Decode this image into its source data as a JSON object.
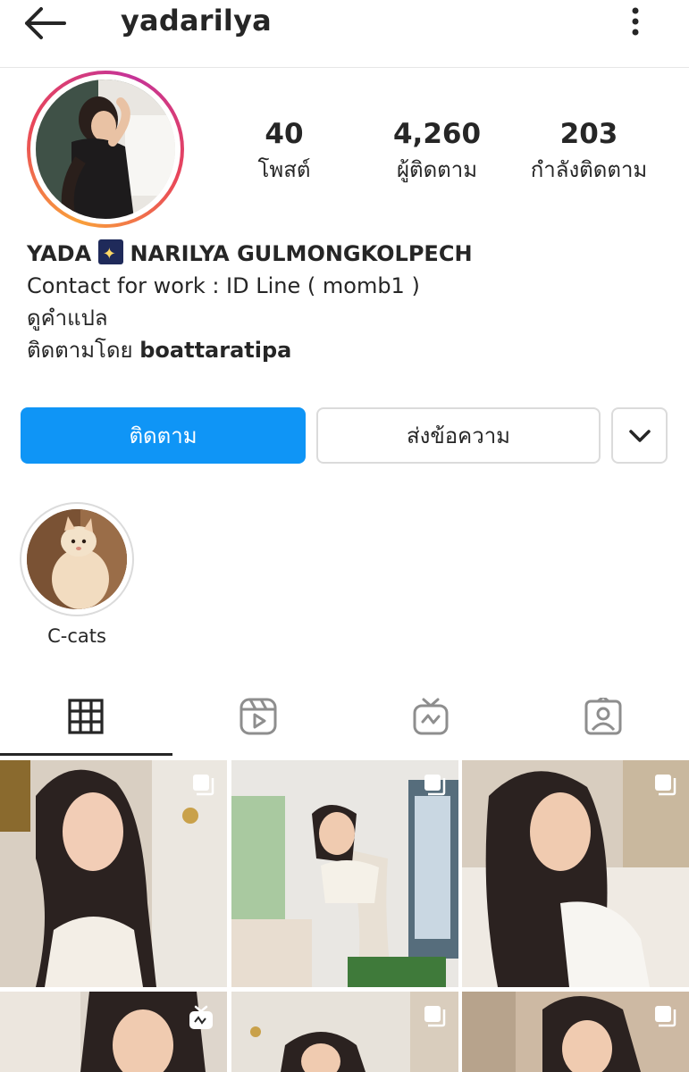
{
  "header": {
    "username": "yadarilya",
    "icons": {
      "back": "arrow-left-icon",
      "menu": "more-vertical-icon"
    }
  },
  "stats": [
    {
      "value": "40",
      "label": "โพสต์"
    },
    {
      "value": "4,260",
      "label": "ผู้ติดตาม"
    },
    {
      "value": "203",
      "label": "กำลังติดตาม"
    }
  ],
  "bio": {
    "name_part1": "YADA",
    "name_emoji": "sparkler-emoji",
    "name_part2": "NARILYA GULMONGKOLPECH",
    "line1": "Contact for work : ID Line ( momb1 )",
    "translate": "ดูคำแปล",
    "followed_by_prefix": "ติดตามโดย",
    "followed_by_user": "boattaratipa"
  },
  "actions": {
    "follow": "ติดตาม",
    "message": "ส่งข้อความ",
    "more_icon": "chevron-down-icon"
  },
  "highlights": [
    {
      "label": "C-cats"
    }
  ],
  "tabs": [
    {
      "icon": "grid-icon",
      "active": true
    },
    {
      "icon": "reels-icon",
      "active": false
    },
    {
      "icon": "igtv-icon",
      "active": false
    },
    {
      "icon": "tagged-icon",
      "active": false
    }
  ],
  "posts": [
    {
      "type": "multi",
      "badge": "carousel-icon"
    },
    {
      "type": "multi",
      "badge": "carousel-icon"
    },
    {
      "type": "multi",
      "badge": "carousel-icon"
    },
    {
      "type": "igtv",
      "badge": "igtv-icon"
    },
    {
      "type": "multi",
      "badge": "carousel-icon"
    },
    {
      "type": "multi",
      "badge": "carousel-icon"
    }
  ],
  "colors": {
    "follow_button": "#0f95f6",
    "text": "#262626",
    "border": "#dbdbdb"
  }
}
